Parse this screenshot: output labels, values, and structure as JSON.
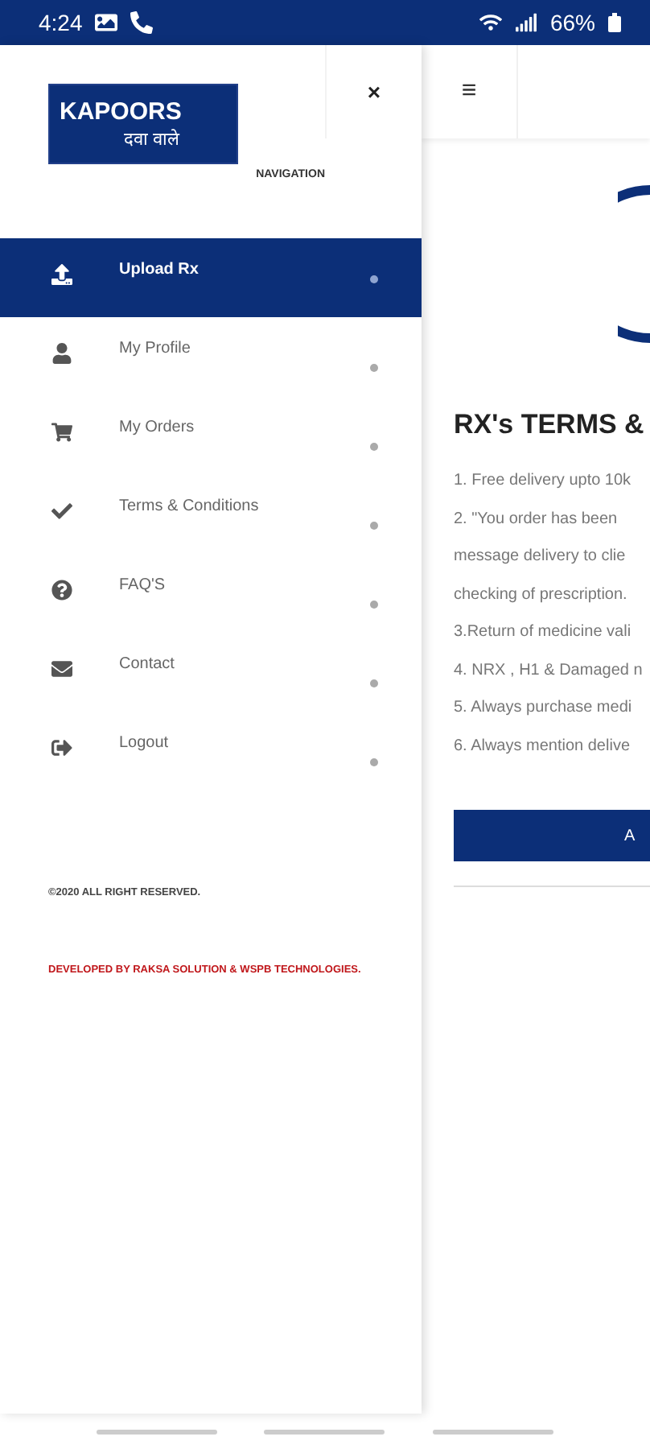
{
  "status_bar": {
    "time": "4:24",
    "battery": "66%"
  },
  "drawer": {
    "logo": {
      "name": "KAPOORS",
      "tagline": "दवा वाले"
    },
    "subtitle": "NAVIGATION",
    "close": "×",
    "items": [
      {
        "label": "Upload Rx",
        "selected": true
      },
      {
        "label": "My Profile",
        "selected": false
      },
      {
        "label": "My Orders",
        "selected": false
      },
      {
        "label": "Terms & Conditions",
        "selected": false
      },
      {
        "label": "FAQ'S",
        "selected": false
      },
      {
        "label": "Contact",
        "selected": false
      },
      {
        "label": "Logout",
        "selected": false
      }
    ],
    "copyright": "©2020 ALL RIGHT RESERVED.",
    "credits": "DEVELOPED BY RAKSA SOLUTION & WSPB TECHNOLOGIES."
  },
  "content": {
    "menu": "≡",
    "title": "RX's TERMS &",
    "terms": [
      "1. Free delivery upto 10k",
      "2. \"You order has been",
      "message delivery to clie",
      "checking of prescription.",
      "3.Return of medicine vali",
      "4. NRX , H1 & Damaged n",
      "5. Always purchase medi",
      "6. Always mention delive"
    ],
    "button": "A"
  }
}
